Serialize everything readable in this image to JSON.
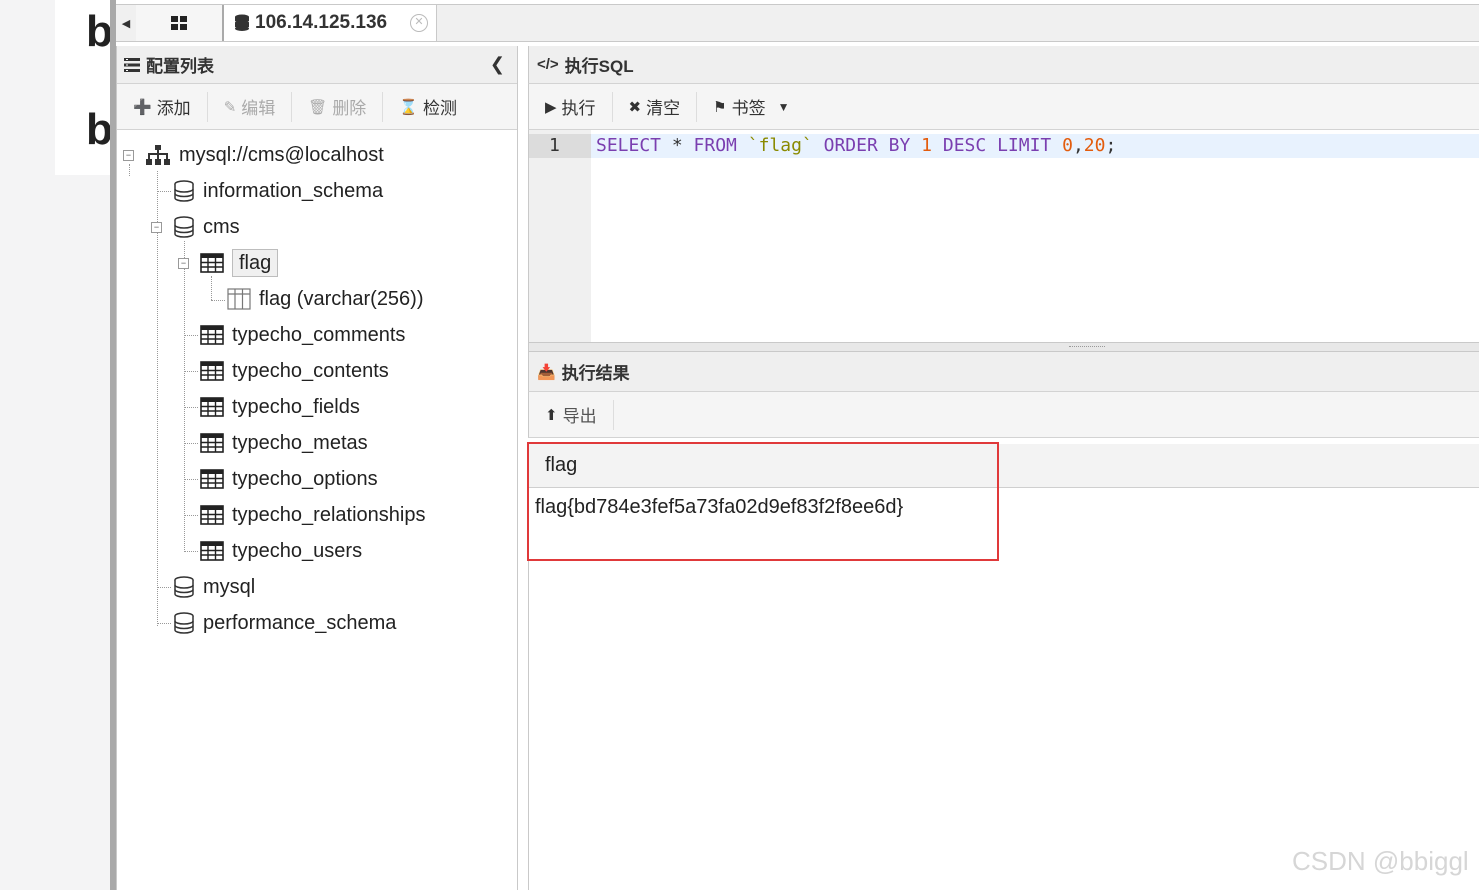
{
  "background": {
    "letters": [
      "b",
      "b"
    ]
  },
  "tabs": {
    "connection": "106.14.125.136"
  },
  "config_panel": {
    "title": "配置列表",
    "buttons": {
      "add": "添加",
      "edit": "编辑",
      "delete": "删除",
      "check": "检测"
    }
  },
  "tree": {
    "root": "mysql://cms@localhost",
    "information_schema": "information_schema",
    "cms": "cms",
    "flag_table": "flag",
    "flag_column": "flag (varchar(256))",
    "tables": [
      "typecho_comments",
      "typecho_contents",
      "typecho_fields",
      "typecho_metas",
      "typecho_options",
      "typecho_relationships",
      "typecho_users"
    ],
    "mysql": "mysql",
    "performance_schema": "performance_schema"
  },
  "sql_panel": {
    "title": "执行SQL",
    "buttons": {
      "run": "执行",
      "clear": "清空",
      "bookmark": "书签"
    },
    "line_number": "1",
    "query_tokens": {
      "select": "SELECT",
      "star": " * ",
      "from": "FROM",
      "sp1": " ",
      "table": "`flag`",
      "sp2": " ",
      "order": "ORDER BY",
      "sp3": " ",
      "one": "1",
      "sp4": " ",
      "desc": "DESC",
      "sp5": " ",
      "limit": "LIMIT",
      "sp6": " ",
      "zero": "0",
      "comma": ",",
      "twenty": "20",
      "semi": ";"
    }
  },
  "result_panel": {
    "title": "执行结果",
    "export": "导出",
    "column": "flag",
    "value": "flag{bd784e3fef5a73fa02d9ef83f2f8ee6d}"
  },
  "colors": {
    "highlight_border": "#e0393a",
    "keyword": "#7a3fb0",
    "string": "#8a8a00",
    "number": "#e35c0d"
  },
  "watermark": "CSDN @bbiggl"
}
